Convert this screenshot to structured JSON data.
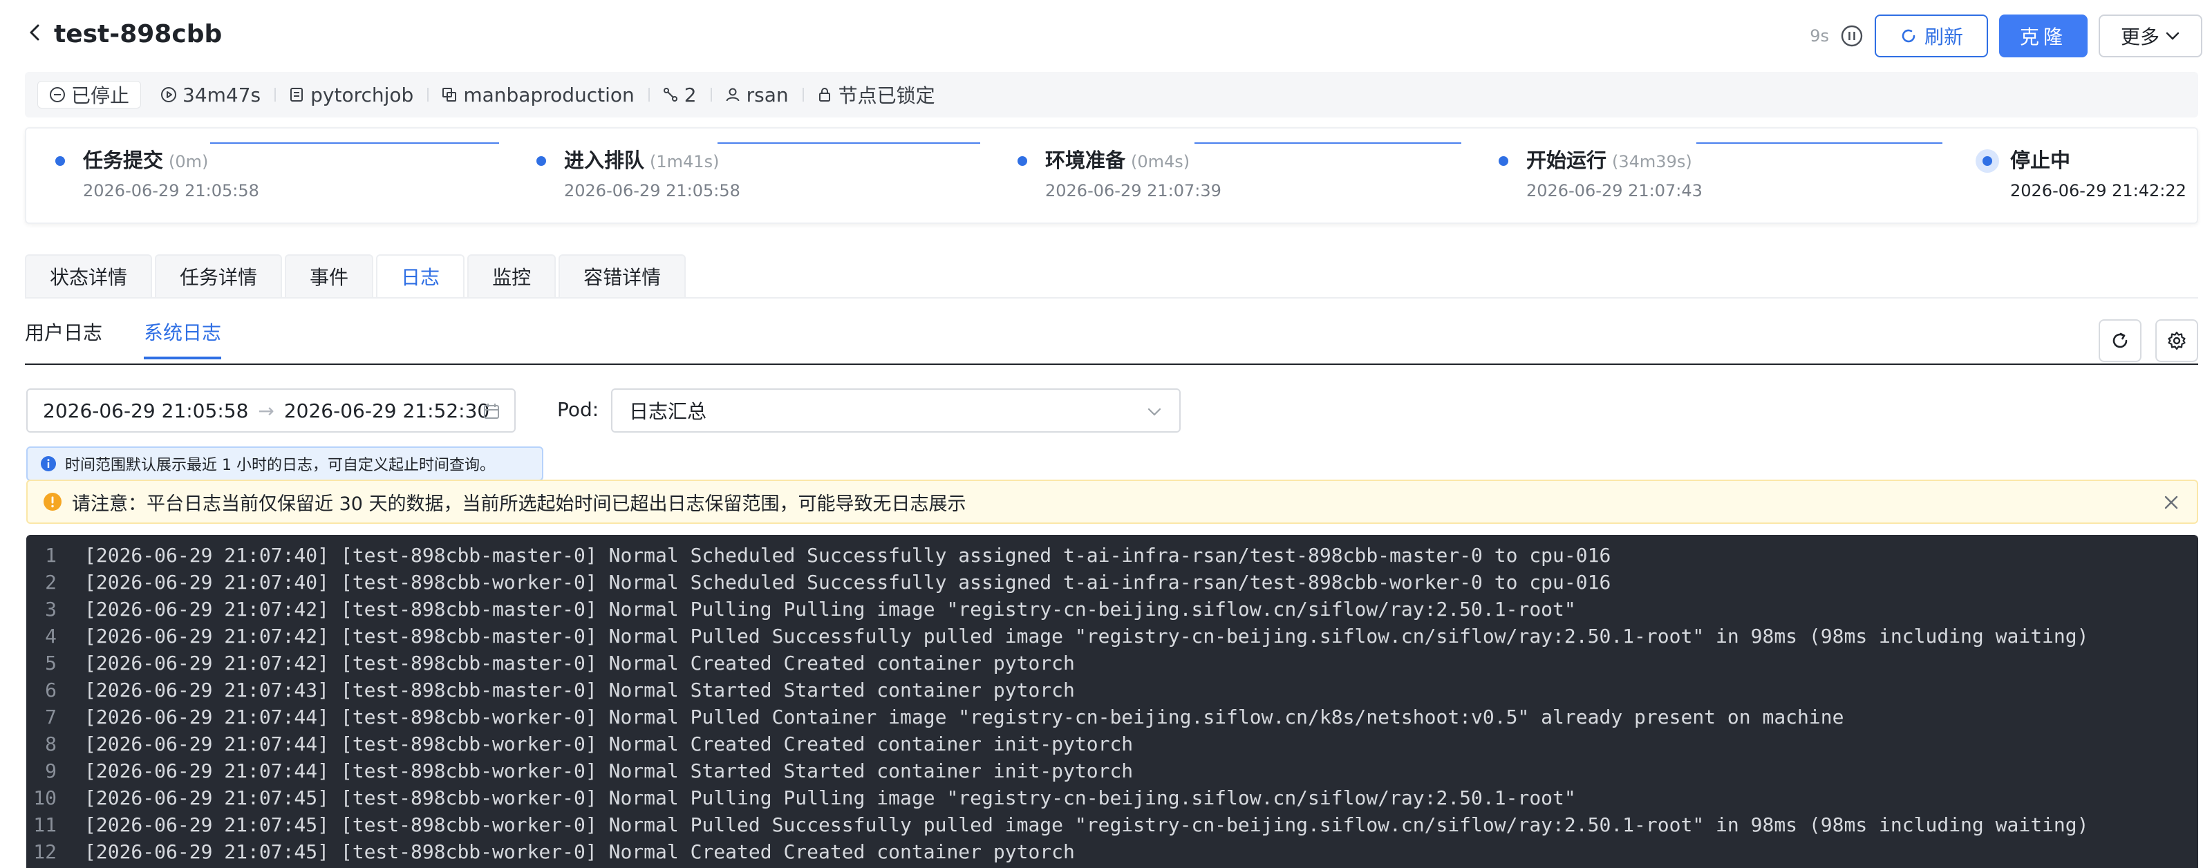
{
  "header": {
    "title": "test-898cbb",
    "countdown": "9s",
    "refresh_label": "刷新",
    "clone_label": "克隆",
    "more_label": "更多"
  },
  "info": {
    "status": "已停止",
    "duration": "34m47s",
    "type": "pytorchjob",
    "cluster": "manbaproduction",
    "replicas": "2",
    "user": "rsan",
    "lock": "节点已锁定"
  },
  "timeline": {
    "steps": [
      {
        "title": "任务提交",
        "duration": "(0m)",
        "time": "2026-06-29 21:05:58"
      },
      {
        "title": "进入排队",
        "duration": "(1m41s)",
        "time": "2026-06-29 21:05:58"
      },
      {
        "title": "环境准备",
        "duration": "(0m4s)",
        "time": "2026-06-29 21:07:39"
      },
      {
        "title": "开始运行",
        "duration": "(34m39s)",
        "time": "2026-06-29 21:07:43"
      },
      {
        "title": "停止中",
        "duration": "",
        "time": "2026-06-29 21:42:22"
      }
    ]
  },
  "tabs": [
    "状态详情",
    "任务详情",
    "事件",
    "日志",
    "监控",
    "容错详情"
  ],
  "active_tab": "日志",
  "subtabs": [
    "用户日志",
    "系统日志"
  ],
  "active_subtab": "系统日志",
  "filters": {
    "start": "2026-06-29 21:05:58",
    "end": "2026-06-29 21:52:30",
    "pod_label": "Pod",
    "pod_value": "日志汇总"
  },
  "hint": "时间范围默认展示最近 1 小时的日志，可自定义起止时间查询。",
  "warning": "请注意：平台日志当前仅保留近 30 天的数据，当前所选起始时间已超出日志保留范围，可能导致无日志展示",
  "logs": [
    {
      "n": "1",
      "text": "[2026-06-29 21:07:40] [test-898cbb-master-0] Normal Scheduled Successfully assigned t-ai-infra-rsan/test-898cbb-master-0 to cpu-016"
    },
    {
      "n": "2",
      "text": "[2026-06-29 21:07:40] [test-898cbb-worker-0] Normal Scheduled Successfully assigned t-ai-infra-rsan/test-898cbb-worker-0 to cpu-016"
    },
    {
      "n": "3",
      "text": "[2026-06-29 21:07:42] [test-898cbb-master-0] Normal Pulling Pulling image \"registry-cn-beijing.siflow.cn/siflow/ray:2.50.1-root\""
    },
    {
      "n": "4",
      "text": "[2026-06-29 21:07:42] [test-898cbb-master-0] Normal Pulled Successfully pulled image \"registry-cn-beijing.siflow.cn/siflow/ray:2.50.1-root\" in 98ms (98ms including waiting)"
    },
    {
      "n": "5",
      "text": "[2026-06-29 21:07:42] [test-898cbb-master-0] Normal Created Created container pytorch"
    },
    {
      "n": "6",
      "text": "[2026-06-29 21:07:43] [test-898cbb-master-0] Normal Started Started container pytorch"
    },
    {
      "n": "7",
      "text": "[2026-06-29 21:07:44] [test-898cbb-worker-0] Normal Pulled Container image \"registry-cn-beijing.siflow.cn/k8s/netshoot:v0.5\" already present on machine"
    },
    {
      "n": "8",
      "text": "[2026-06-29 21:07:44] [test-898cbb-worker-0] Normal Created Created container init-pytorch"
    },
    {
      "n": "9",
      "text": "[2026-06-29 21:07:44] [test-898cbb-worker-0] Normal Started Started container init-pytorch"
    },
    {
      "n": "10",
      "text": "[2026-06-29 21:07:45] [test-898cbb-worker-0] Normal Pulling Pulling image \"registry-cn-beijing.siflow.cn/siflow/ray:2.50.1-root\""
    },
    {
      "n": "11",
      "text": "[2026-06-29 21:07:45] [test-898cbb-worker-0] Normal Pulled Successfully pulled image \"registry-cn-beijing.siflow.cn/siflow/ray:2.50.1-root\" in 98ms (98ms including waiting)"
    },
    {
      "n": "12",
      "text": "[2026-06-29 21:07:45] [test-898cbb-worker-0] Normal Created Created container pytorch"
    }
  ],
  "colors": {
    "accent": "#2f6fe4",
    "primary_button": "#3f7cf4",
    "console_bg": "#272b33",
    "warning_bg": "#fffbe8",
    "hint_bg": "#e8f1fd"
  }
}
